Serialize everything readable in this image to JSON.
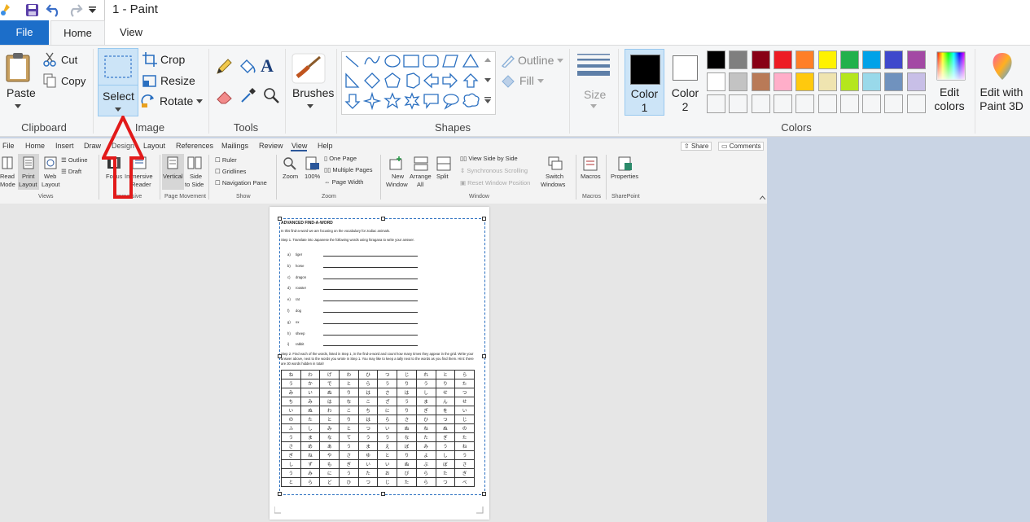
{
  "window": {
    "title": "1 - Paint"
  },
  "tabs": {
    "file": "File",
    "home": "Home",
    "view": "View"
  },
  "clipboard": {
    "paste": "Paste",
    "cut": "Cut",
    "copy": "Copy",
    "label": "Clipboard"
  },
  "image": {
    "select": "Select",
    "crop": "Crop",
    "resize": "Resize",
    "rotate": "Rotate",
    "label": "Image"
  },
  "tools": {
    "label": "Tools"
  },
  "brushes": {
    "label": "Brushes"
  },
  "shapes": {
    "outline": "Outline",
    "fill": "Fill",
    "label": "Shapes"
  },
  "size": {
    "label": "Size"
  },
  "colors": {
    "color1_a": "Color",
    "color1_b": "1",
    "color2_a": "Color",
    "color2_b": "2",
    "label": "Colors",
    "edit_a": "Edit",
    "edit_b": "colors",
    "paint3d_a": "Edit with",
    "paint3d_b": "Paint 3D",
    "palette_row1": [
      "#000000",
      "#7f7f7f",
      "#880015",
      "#ed1c24",
      "#ff7f27",
      "#fff200",
      "#22b14c",
      "#00a2e8",
      "#3f48cc",
      "#a349a4"
    ],
    "palette_row2": [
      "#ffffff",
      "#c3c3c3",
      "#b97a57",
      "#ffaec9",
      "#ffc90e",
      "#efe4b0",
      "#b5e61d",
      "#99d9ea",
      "#7092be",
      "#c8bfe7"
    ]
  },
  "word": {
    "tabs": [
      "File",
      "Home",
      "Insert",
      "Draw",
      "Design",
      "Layout",
      "References",
      "Mailings",
      "Review",
      "View",
      "Help"
    ],
    "share": "Share",
    "comments": "Comments",
    "views": {
      "read_a": "Read",
      "read_b": "Mode",
      "print_a": "Print",
      "print_b": "Layout",
      "web_a": "Web",
      "web_b": "Layout",
      "outline": "Outline",
      "draft": "Draft",
      "label": "Views"
    },
    "immersive": {
      "focus": "Focus",
      "imm_a": "Immersive",
      "imm_b": "Reader",
      "label": "Immersive"
    },
    "movement": {
      "vertical": "Vertical",
      "side_a": "Side",
      "side_b": "to Side",
      "label": "Page Movement"
    },
    "show": {
      "ruler": "Ruler",
      "gridlines": "Gridlines",
      "nav": "Navigation Pane",
      "label": "Show"
    },
    "zoom": {
      "zoom": "Zoom",
      "pct": "100%",
      "one": "One Page",
      "multiple": "Multiple Pages",
      "width": "Page Width",
      "label": "Zoom"
    },
    "window": {
      "new_a": "New",
      "new_b": "Window",
      "arr_a": "Arrange",
      "arr_b": "All",
      "split": "Split",
      "sbs": "View Side by Side",
      "sync": "Synchronous Scrolling",
      "reset": "Reset Window Position",
      "switch_a": "Switch",
      "switch_b": "Windows",
      "label": "Window"
    },
    "macros": {
      "macros": "Macros",
      "label": "Macros"
    },
    "sharepoint": {
      "props": "Properties",
      "label": "SharePoint"
    }
  },
  "doc": {
    "title": "ADVANCED FIND-A-WORD",
    "intro": "In this find-a-word we are focusing on the vocabulary for zodiac animals.",
    "step1": "Step 1. Translate into Japanese the following words using hiragana to write your answer.",
    "words": [
      {
        "letter": "a)",
        "word": "tiger"
      },
      {
        "letter": "b)",
        "word": "horse"
      },
      {
        "letter": "c)",
        "word": "dragon"
      },
      {
        "letter": "d)",
        "word": "rooster"
      },
      {
        "letter": "e)",
        "word": "rat"
      },
      {
        "letter": "f)",
        "word": "dog"
      },
      {
        "letter": "g)",
        "word": "ox"
      },
      {
        "letter": "h)",
        "word": "sheep"
      },
      {
        "letter": "i)",
        "word": "rabbit"
      }
    ],
    "step2": "Step 2. Find each of the words, listed in Step 1, in the find-a-word and count how many times they appear in the grid. Write your answer above, next to the words you wrote in Step 1. You may like to keep a tally next to the words as you find them. Hint: there are 30 words hidden in total!",
    "grid": [
      [
        "ね",
        "わ",
        "げ",
        "わ",
        "ひ",
        "つ",
        "じ",
        "れ",
        "と",
        "ら"
      ],
      [
        "う",
        "か",
        "で",
        "と",
        "ら",
        "う",
        "り",
        "う",
        "り",
        "た"
      ],
      [
        "み",
        "い",
        "ぬ",
        "り",
        "は",
        "さ",
        "は",
        "し",
        "せ",
        "つ"
      ],
      [
        "ち",
        "み",
        "は",
        "な",
        "こ",
        "ざ",
        "う",
        "ま",
        "ん",
        "せ"
      ],
      [
        "い",
        "ぬ",
        "わ",
        "こ",
        "ち",
        "に",
        "り",
        "ぎ",
        "を",
        "い"
      ],
      [
        "の",
        "た",
        "と",
        "り",
        "は",
        "ら",
        "さ",
        "ひ",
        "つ",
        "じ"
      ],
      [
        "ふ",
        "し",
        "み",
        "と",
        "つ",
        "い",
        "ぬ",
        "ね",
        "ぬ",
        "の"
      ],
      [
        "う",
        "ま",
        "な",
        "て",
        "う",
        "う",
        "な",
        "た",
        "ぎ",
        "た"
      ],
      [
        "さ",
        "め",
        "あ",
        "う",
        "ま",
        "え",
        "ぼ",
        "み",
        "う",
        "ね"
      ],
      [
        "ぎ",
        "ね",
        "や",
        "さ",
        "ゆ",
        "と",
        "り",
        "よ",
        "し",
        "う"
      ],
      [
        "し",
        "ず",
        "も",
        "ぎ",
        "い",
        "い",
        "ぬ",
        "ぶ",
        "ぼ",
        "さ"
      ],
      [
        "う",
        "み",
        "に",
        "う",
        "た",
        "お",
        "び",
        "ら",
        "た",
        "ぎ"
      ],
      [
        "と",
        "ら",
        "ど",
        "ひ",
        "つ",
        "じ",
        "た",
        "ら",
        "つ",
        "べ"
      ]
    ]
  }
}
